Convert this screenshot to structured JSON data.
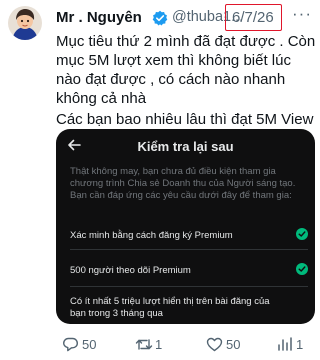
{
  "tweet": {
    "display_name": "Mr . Nguyên",
    "handle": "@thuba1...",
    "separator": "·",
    "date": "6/7/26",
    "more": "···",
    "text_lines": [
      "Mục tiêu thứ 2 mình đã đạt được . Còn mục 5M lượt xem thì không biết lúc nào đạt được , có cách nào nhanh không cả nhà",
      "Các bạn bao nhiêu lâu thì đạt 5M View"
    ]
  },
  "card": {
    "title": "Kiểm tra lại sau",
    "description": "Thật không may, bạn chưa đủ điều kiện tham gia chương trình Chia sẻ Doanh thu của Người sáng tạo. Bạn cần đáp ứng các yêu cầu dưới đây để tham gia:",
    "requirements": [
      {
        "label": "Xác minh bằng cách đăng ký Premium",
        "met": true
      },
      {
        "label": "500 người theo dõi Premium",
        "met": true
      },
      {
        "label": "Có ít nhất 5 triệu lượt hiển thị trên bài đăng của bạn trong 3 tháng qua",
        "met": false
      }
    ],
    "check_color": "#00ba7c",
    "background": "#0f0f10"
  },
  "actions": {
    "replies": "50",
    "reposts": "1",
    "likes": "50",
    "views": "1"
  },
  "colors": {
    "highlight_box": "#e0162b",
    "verified": "#1d9bf0",
    "muted": "#536471"
  }
}
